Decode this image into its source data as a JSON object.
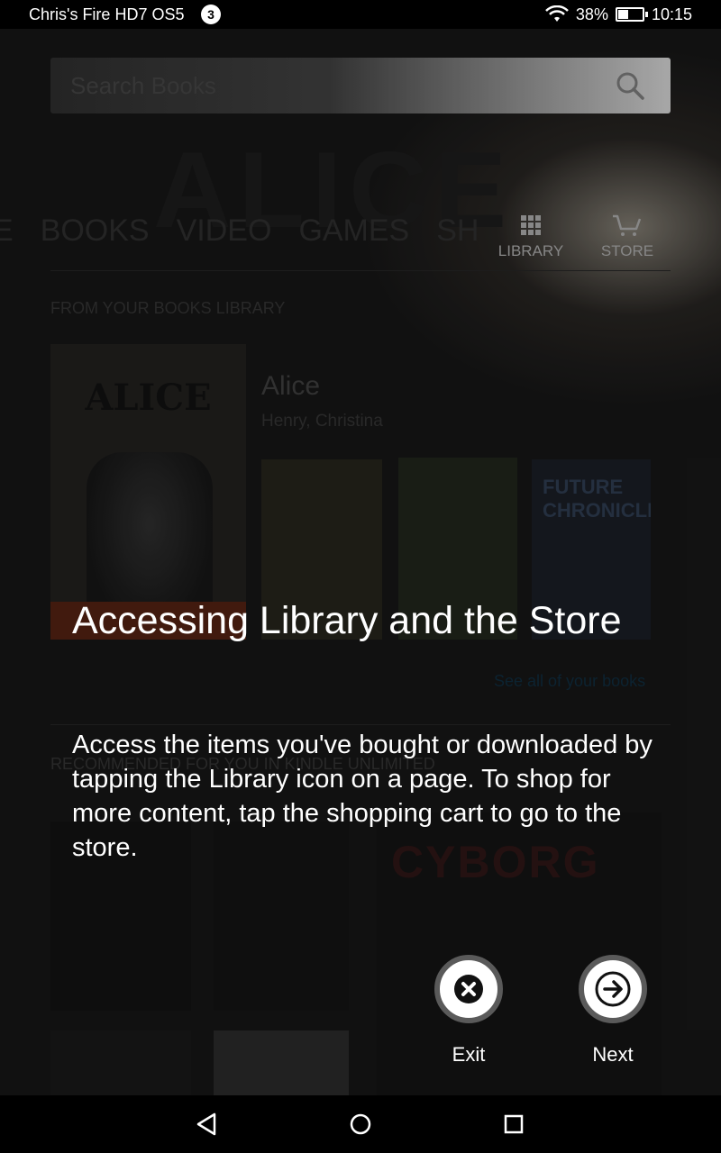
{
  "status_bar": {
    "device_name": "Chris's Fire HD7 OS5",
    "notification_count": "3",
    "battery": "38%",
    "battery_level": 0.38,
    "time": "10:15"
  },
  "search": {
    "placeholder": "Search Books"
  },
  "nav": {
    "tabs": [
      "E",
      "BOOKS",
      "VIDEO",
      "GAMES",
      "SH"
    ],
    "library_label": "LIBRARY",
    "store_label": "STORE"
  },
  "library_section": {
    "heading": "FROM YOUR BOOKS LIBRARY",
    "featured_cover_title": "ALICE",
    "featured_title": "Alice",
    "featured_author": "Henry, Christina",
    "cover3_title": "FUTURE CHRONICLES",
    "see_all": "See all of your books"
  },
  "recommended_section": {
    "heading": "RECOMMENDED FOR YOU IN KINDLE UNLIMITED",
    "cover_title": "CYBORG"
  },
  "tour": {
    "title": "Accessing Library and the Store",
    "body": "Access the items you've bought or downloaded by tapping the Library icon on a page. To shop for more content, tap the shopping cart to go to the store.",
    "exit_label": "Exit",
    "next_label": "Next"
  }
}
